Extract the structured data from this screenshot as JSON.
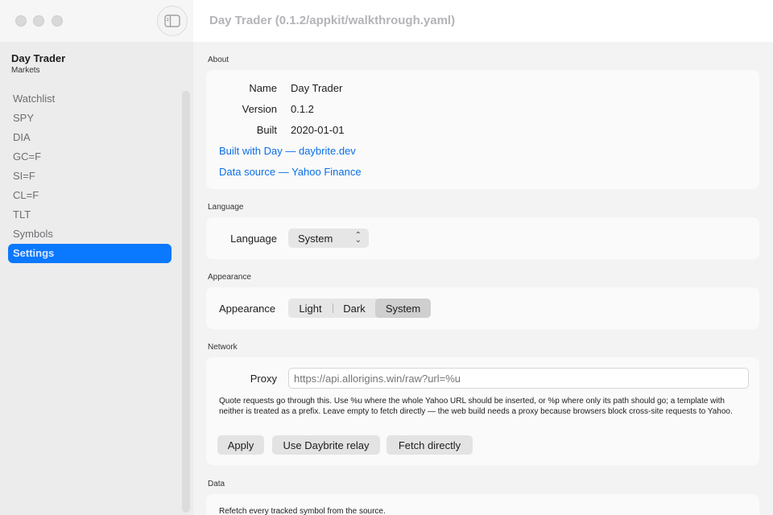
{
  "window": {
    "title": "Day Trader (0.1.2/appkit/walkthrough.yaml)"
  },
  "sidebar": {
    "app_name": "Day Trader",
    "app_subtitle": "Markets",
    "items": [
      {
        "label": "Watchlist",
        "active": false
      },
      {
        "label": "SPY",
        "active": false
      },
      {
        "label": "DIA",
        "active": false
      },
      {
        "label": "GC=F",
        "active": false
      },
      {
        "label": "SI=F",
        "active": false
      },
      {
        "label": "CL=F",
        "active": false
      },
      {
        "label": "TLT",
        "active": false
      },
      {
        "label": "Symbols",
        "active": false
      },
      {
        "label": "Settings",
        "active": true
      }
    ],
    "accent_color": "#0a78ff"
  },
  "about": {
    "section": "About",
    "name_key": "Name",
    "name_val": "Day Trader",
    "version_key": "Version",
    "version_val": "0.1.2",
    "built_key": "Built",
    "built_val": "2020-01-01",
    "link_built_with": "Built with Day — daybrite.dev",
    "link_data_source": "Data source — Yahoo Finance"
  },
  "language": {
    "section": "Language",
    "label": "Language",
    "selected": "System"
  },
  "appearance": {
    "section": "Appearance",
    "label": "Appearance",
    "options": [
      "Light",
      "Dark",
      "System"
    ],
    "selected": "System"
  },
  "network": {
    "section": "Network",
    "proxy_label": "Proxy",
    "proxy_placeholder": "https://api.allorigins.win/raw?url=%u",
    "help_text": "Quote requests go through this. Use %u where the whole Yahoo URL should be inserted, or %p where only its path should go; a template with neither is treated as a prefix. Leave empty to fetch directly — the web build needs a proxy because browsers block cross-site requests to Yahoo.",
    "apply_label": "Apply",
    "relay_label": "Use Daybrite relay",
    "direct_label": "Fetch directly"
  },
  "data": {
    "section": "Data",
    "refetch_text": "Refetch every tracked symbol from the source."
  }
}
